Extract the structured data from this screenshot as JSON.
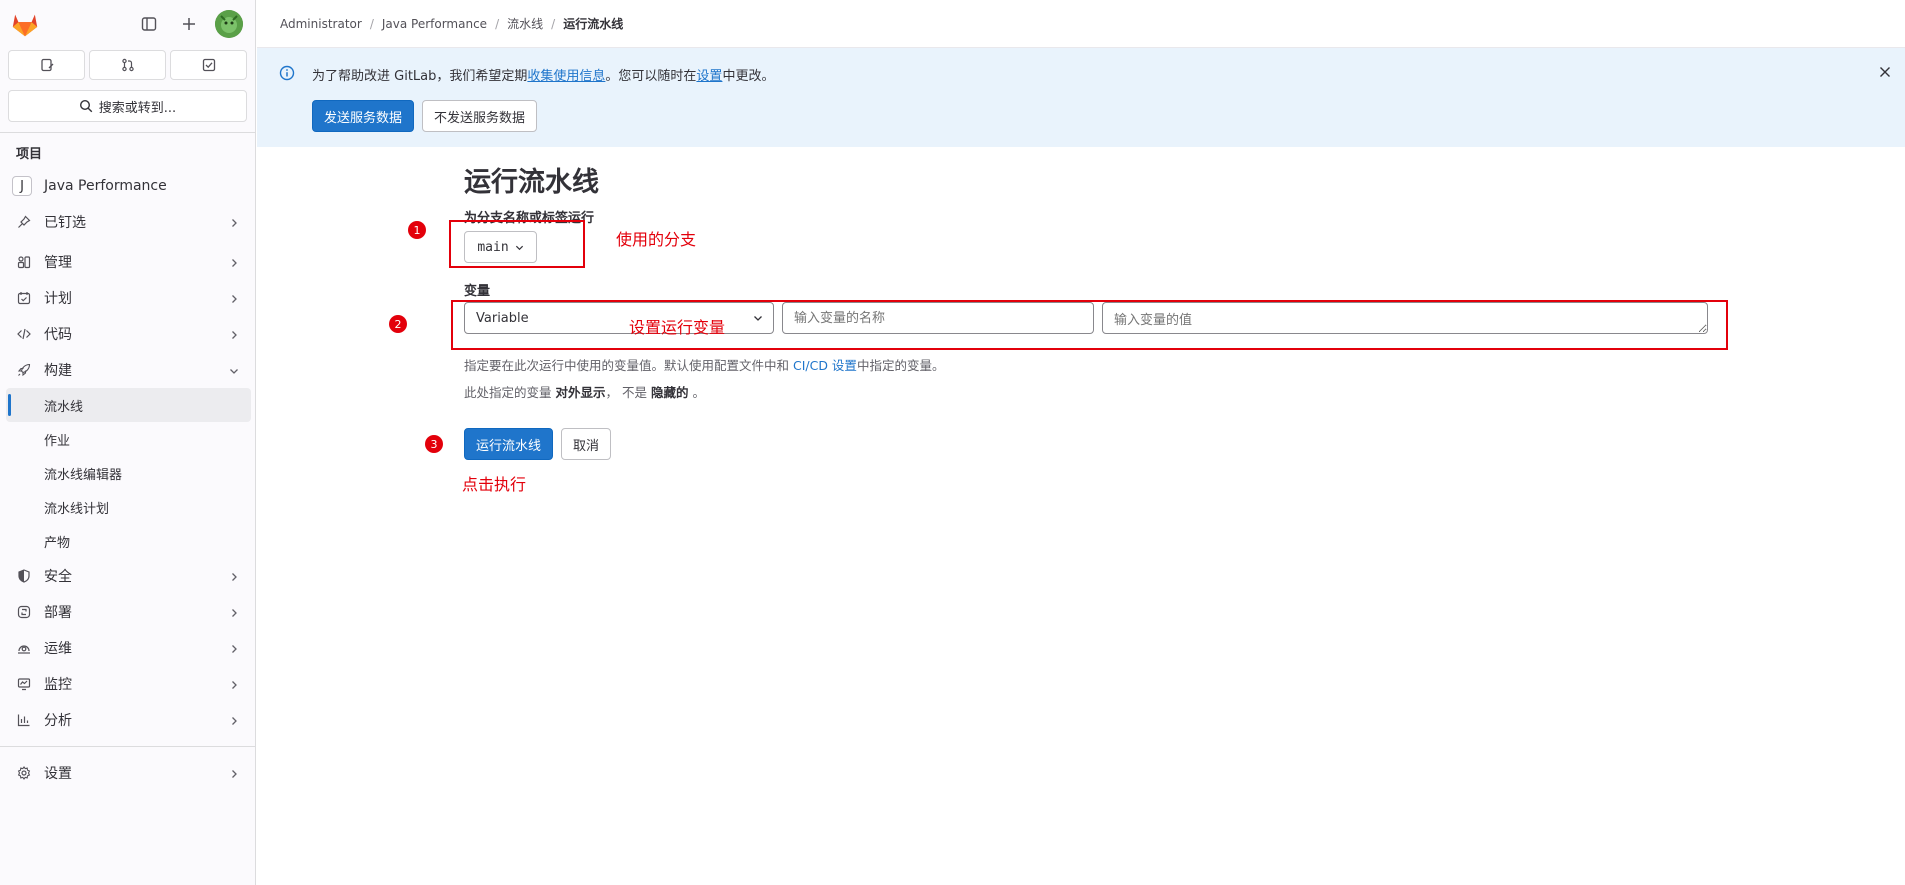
{
  "sidebar": {
    "search_label": "搜索或转到...",
    "section_title": "项目",
    "project": {
      "badge": "J",
      "name": "Java Performance"
    },
    "items": [
      {
        "label": "已钉选",
        "icon": "pin-icon"
      },
      {
        "label": "管理",
        "icon": "manage-icon"
      },
      {
        "label": "计划",
        "icon": "plan-icon"
      },
      {
        "label": "代码",
        "icon": "code-icon"
      },
      {
        "label": "构建",
        "icon": "rocket-icon"
      }
    ],
    "build_subitems": [
      "流水线",
      "作业",
      "流水线编辑器",
      "流水线计划",
      "产物"
    ],
    "items_after": [
      {
        "label": "安全",
        "icon": "shield-icon"
      },
      {
        "label": "部署",
        "icon": "deploy-icon"
      },
      {
        "label": "运维",
        "icon": "operate-icon"
      },
      {
        "label": "监控",
        "icon": "monitor-icon"
      },
      {
        "label": "分析",
        "icon": "chart-icon"
      }
    ],
    "settings_label": "设置"
  },
  "breadcrumb": {
    "items": [
      "Administrator",
      "Java Performance",
      "流水线"
    ],
    "current": "运行流水线"
  },
  "banner": {
    "text_before": "为了帮助改进 GitLab，我们希望定期",
    "link1": "收集使用信息",
    "text_middle": "。您可以随时在",
    "link2": "设置",
    "text_after": "中更改。",
    "send_button": "发送服务数据",
    "dont_send_button": "不发送服务数据"
  },
  "form": {
    "title": "运行流水线",
    "branch_label": "为分支名称或标签运行",
    "branch_value": "main",
    "variables_label": "变量",
    "variable_type": "Variable",
    "variable_name_placeholder": "输入变量的名称",
    "variable_value_placeholder": "输入变量的值",
    "help1_before": "指定要在此次运行中使用的变量值。默认使用配置文件中和 ",
    "help1_link": "CI/CD 设置",
    "help1_after": "中指定的变量。",
    "help2_before": "此处指定的变量 ",
    "help2_bold1": "对外显示",
    "help2_middle": "， 不是 ",
    "help2_bold2": "隐藏的",
    "help2_after": " 。",
    "run_button": "运行流水线",
    "cancel_button": "取消"
  },
  "annotations": {
    "num1": "1",
    "text1": "使用的分支",
    "num2": "2",
    "text2": "设置运行变量",
    "num3": "3",
    "text3": "点击执行"
  }
}
